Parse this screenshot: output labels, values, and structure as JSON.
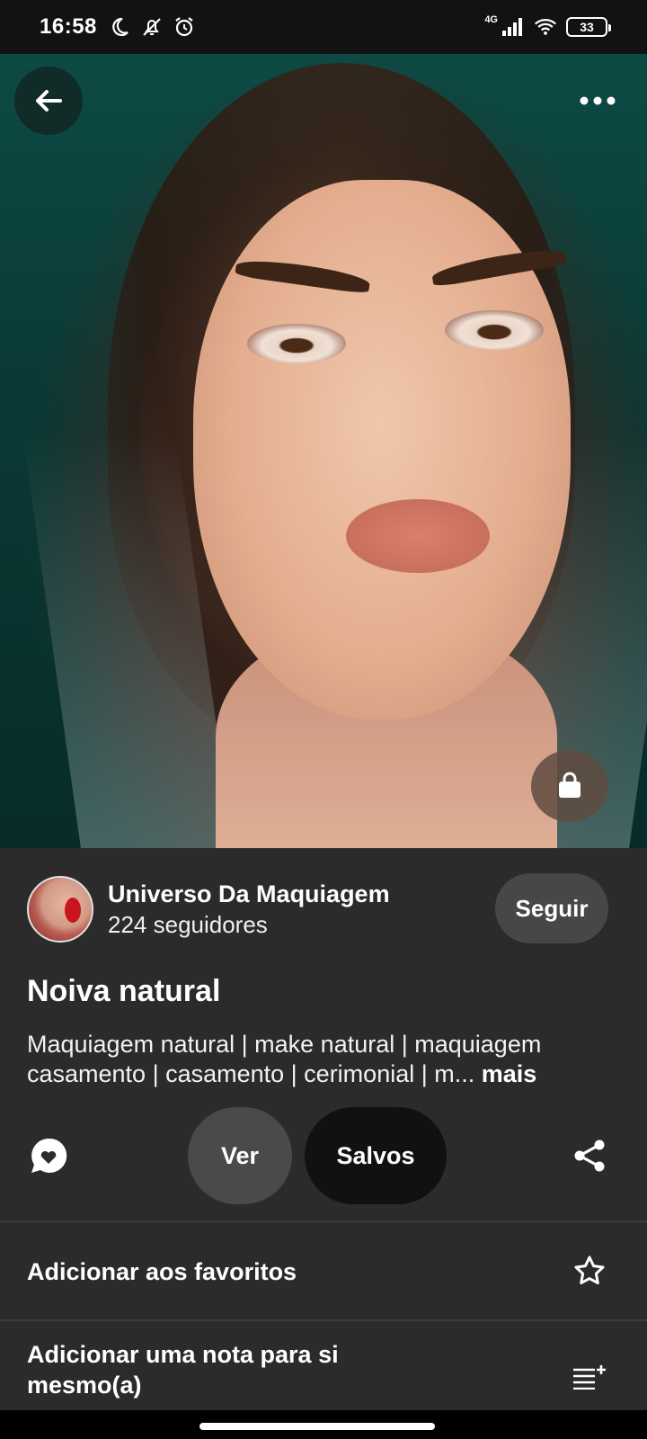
{
  "status_bar": {
    "time": "16:58",
    "network": "4G",
    "battery": "33",
    "icons_left": [
      "moon-icon",
      "muted-bell-icon",
      "alarm-icon"
    ],
    "icons_right": [
      "signal-icon",
      "wifi-icon",
      "battery-icon"
    ]
  },
  "pin": {
    "creator": {
      "name": "Universo Da Maquiagem",
      "followers": "224 seguidores",
      "follow_label": "Seguir"
    },
    "title": "Noiva natural",
    "description": "Maquiagem natural | make natural | maquiagem casamento | casamento | cerimonial | m...",
    "more_label": "mais"
  },
  "actions": {
    "ver_label": "Ver",
    "salvos_label": "Salvos"
  },
  "options": [
    {
      "label": "Adicionar aos favoritos",
      "icon": "star-icon"
    },
    {
      "label": "Adicionar uma nota para si mesmo(a)",
      "icon": "add-note-icon"
    }
  ],
  "colors": {
    "panel": "#2b2b2b",
    "button_gray": "#4a4a4a",
    "button_dark": "#111111",
    "status_bar": "#121212"
  }
}
